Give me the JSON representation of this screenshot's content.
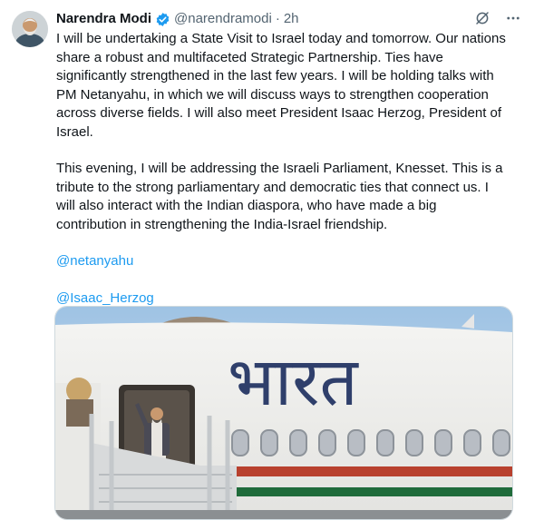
{
  "author": {
    "name": "Narendra Modi",
    "handle": "@narendramodi",
    "separator": "·",
    "time": "2h"
  },
  "icons": {
    "avatar": "user-avatar",
    "verified": "verified-badge-icon",
    "grok": "grok-icon",
    "more": "more-options-icon"
  },
  "tweet": {
    "paragraph_1": "I will be undertaking a State Visit to Israel today and tomorrow. Our nations share a robust and multifaceted Strategic Partnership. Ties have significantly strengthened in the last few years. I will be holding talks with PM Netanyahu, in which we will discuss ways to strengthen cooperation across diverse fields. I will also meet President Isaac Herzog, President of Israel.",
    "paragraph_2": "This evening, I will be addressing the Israeli Parliament, Knesset. This is a tribute to the strong parliamentary and democratic ties that connect us. I will also interact with the Indian diaspora, who have made a big contribution in strengthening the India-Israel friendship.",
    "mentions": [
      "@netanyahu",
      "@Isaac_Herzog"
    ]
  },
  "media": {
    "aircraft_lettering": "भारत"
  },
  "colors": {
    "link": "#1d9bf0",
    "verified": "#1d9bf0",
    "secondary_text": "#536471"
  }
}
